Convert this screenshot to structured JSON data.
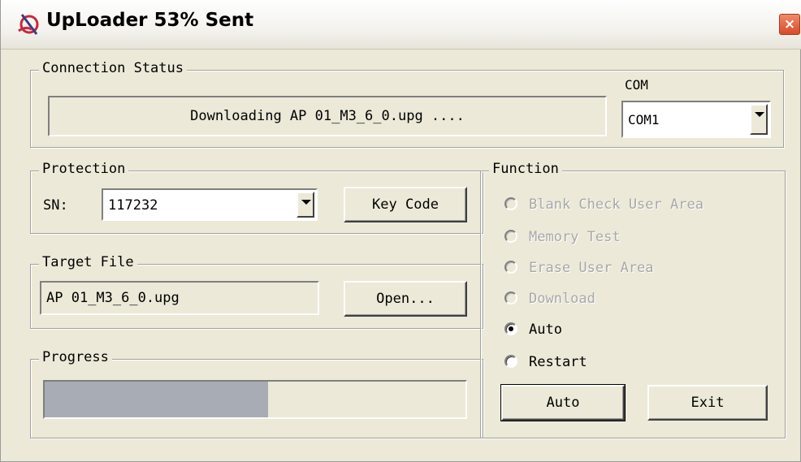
{
  "window": {
    "title": "UpLoader 53% Sent",
    "close_glyph": "×",
    "app_icon": "uploader-app-icon"
  },
  "connection": {
    "legend": "Connection Status",
    "status_text": "Downloading AP 01_M3_6_0.upg ....",
    "com_label": "COM",
    "com_value": "COM1"
  },
  "protection": {
    "legend": "Protection",
    "sn_label": "SN:",
    "sn_value": "117232",
    "key_code_label": "Key Code"
  },
  "target_file": {
    "legend": "Target File",
    "file_value": "AP 01_M3_6_0.upg",
    "open_label": "Open..."
  },
  "progress": {
    "legend": "Progress",
    "fraction": 0.53
  },
  "function": {
    "legend": "Function",
    "options": [
      {
        "label": "Blank Check User Area",
        "enabled": false,
        "checked": false
      },
      {
        "label": "Memory Test",
        "enabled": false,
        "checked": false
      },
      {
        "label": "Erase User Area",
        "enabled": false,
        "checked": false
      },
      {
        "label": "Download",
        "enabled": false,
        "checked": false
      },
      {
        "label": "Auto",
        "enabled": true,
        "checked": true
      },
      {
        "label": "Restart",
        "enabled": true,
        "checked": false
      }
    ],
    "auto_button_label": "Auto",
    "exit_button_label": "Exit"
  },
  "colors": {
    "progress_fill": "#a8acb4",
    "disabled_text": "#a8a8a8",
    "window_bg": "#ece9d8"
  }
}
